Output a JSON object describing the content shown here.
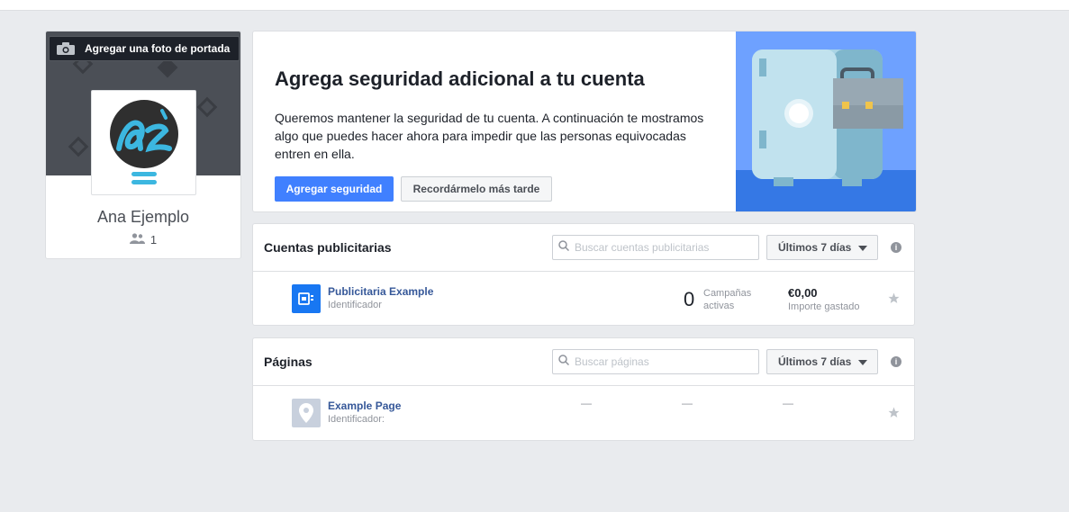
{
  "profile": {
    "cover_button_label": "Agregar una foto de portada",
    "name": "Ana Ejemplo",
    "friends_count": "1"
  },
  "banner": {
    "title": "Agrega seguridad adicional a tu cuenta",
    "description": "Queremos mantener la seguridad de tu cuenta. A continuación te mostramos algo que puedes hacer ahora para impedir que las personas equivocadas entren en ella.",
    "primary_label": "Agregar seguridad",
    "secondary_label": "Recordármelo más tarde"
  },
  "ad_accounts": {
    "title": "Cuentas publicitarias",
    "search_placeholder": "Buscar cuentas publicitarias",
    "range_label": "Últimos 7 días",
    "rows": [
      {
        "name": "Publicitaria Example",
        "sub": "Identificador",
        "campaigns_count": "0",
        "campaigns_label_1": "Campañas",
        "campaigns_label_2": "activas",
        "amount": "€0,00",
        "amount_label": "Importe gastado"
      }
    ]
  },
  "pages": {
    "title": "Páginas",
    "search_placeholder": "Buscar páginas",
    "range_label": "Últimos 7 días",
    "rows": [
      {
        "name": "Example Page",
        "sub": "Identificador:",
        "dash1": "—",
        "dash2": "—",
        "dash3": "—"
      }
    ]
  },
  "colors": {
    "primary": "#4080ff",
    "link": "#365899",
    "background": "#e9ebee"
  },
  "icons": [
    "camera-icon",
    "friends-icon",
    "search-icon",
    "caret-down-icon",
    "info-icon",
    "star-icon",
    "ad-account-icon",
    "page-location-icon"
  ]
}
